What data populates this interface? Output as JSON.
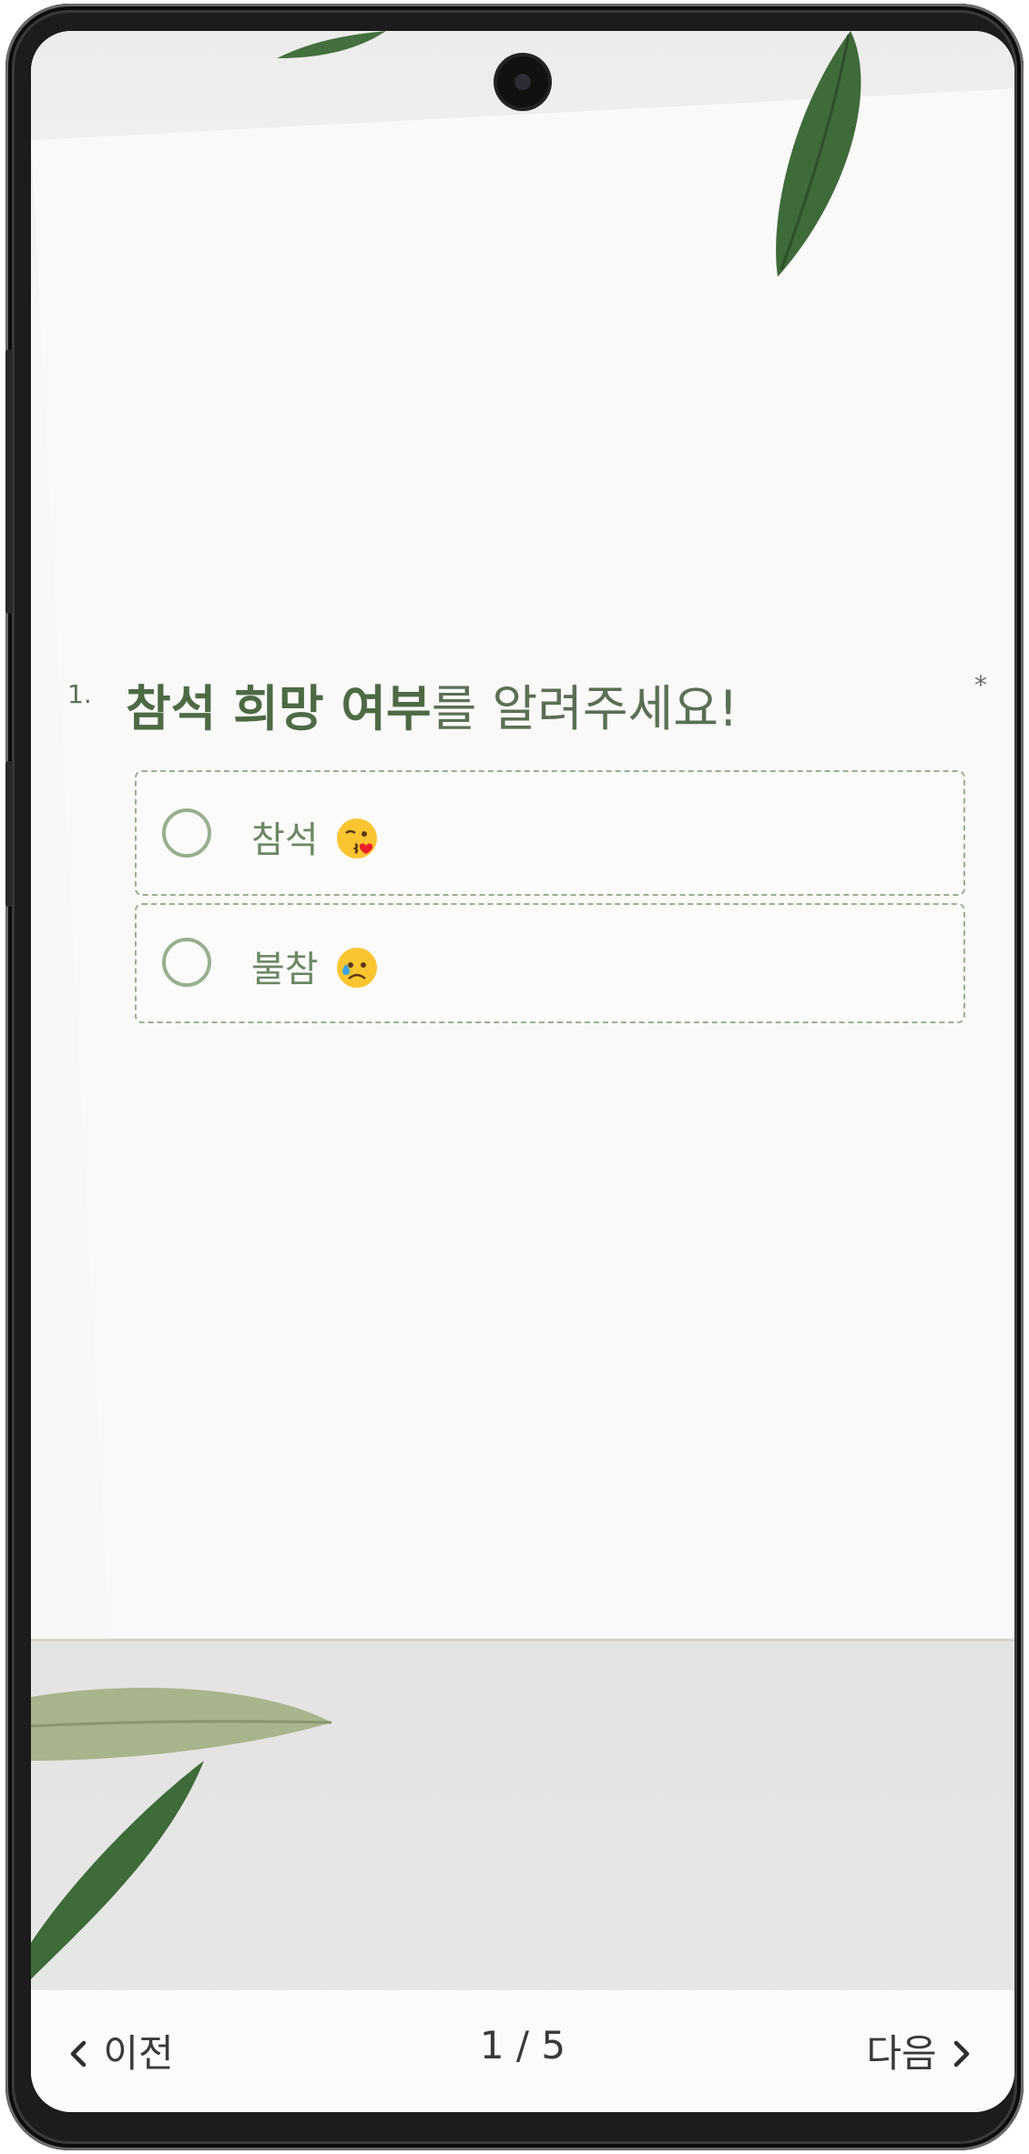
{
  "question": {
    "number": "1.",
    "title_bold": "참석 희망 여부",
    "title_rest": "를 알려주세요!",
    "required_mark": "*",
    "options": [
      {
        "label": "참석",
        "emoji_icon": "kissing-heart-emoji"
      },
      {
        "label": "불참",
        "emoji_icon": "sad-sweat-emoji"
      }
    ]
  },
  "footer": {
    "prev_label": "이전",
    "page_indicator": "1 / 5",
    "next_label": "다음"
  },
  "colors": {
    "accent_green": "#5b6f55",
    "option_border": "#97b08e",
    "option_text": "#6b8863"
  }
}
